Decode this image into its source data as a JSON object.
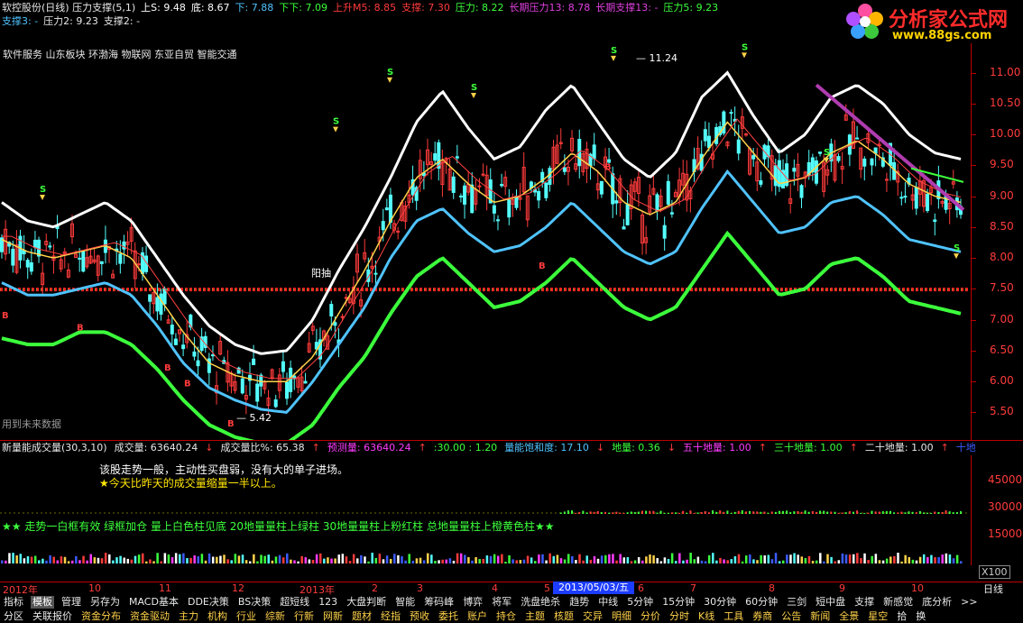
{
  "header": {
    "row1": [
      {
        "text": "软控股份(日线) 压力支撑(5,1)",
        "color": "#e8e8e8"
      },
      {
        "text": "上S: 9.48",
        "color": "#ffffff"
      },
      {
        "text": "底: 8.67",
        "color": "#ffffff"
      },
      {
        "text": "下: 7.88",
        "color": "#4fc3ff"
      },
      {
        "text": "下下: 7.09",
        "color": "#3cff3c"
      },
      {
        "text": "上升M5: 8.85",
        "color": "#ff3b3b"
      },
      {
        "text": "支撑: 7.30",
        "color": "#ff3b3b"
      },
      {
        "text": "压力: 8.22",
        "color": "#3cff3c"
      },
      {
        "text": "长期压力13: 8.78",
        "color": "#e040e0"
      },
      {
        "text": "长期支撑13: -",
        "color": "#e040e0"
      },
      {
        "text": "压力5: 9.23",
        "color": "#3cff3c"
      }
    ],
    "row2": [
      {
        "text": "支撑3: -",
        "color": "#4fc3ff"
      },
      {
        "text": "压力2: 9.23",
        "color": "#e8e8e8"
      },
      {
        "text": "支撑2: -",
        "color": "#e8e8e8"
      }
    ],
    "sectors": "软件服务 山东板块 环渤海 物联网 东亚自贸 智能交通"
  },
  "logo": {
    "title": "分析家公式网",
    "url": "www.88gs.com"
  },
  "price_axis": {
    "ticks": [
      "11.00",
      "10.50",
      "10.00",
      "9.50",
      "9.00",
      "8.50",
      "8.00",
      "7.50",
      "7.00",
      "6.50",
      "6.00",
      "5.50"
    ]
  },
  "annotations": {
    "high_label": "11.24",
    "low_label": "5.42",
    "future_data": "用到未来数据",
    "yinyang_label": "阳抽"
  },
  "volume_header": [
    {
      "text": "新量能成交量(30,3,10)",
      "color": "#e8e8e8"
    },
    {
      "text": "成交量: 63640.24",
      "color": "#e8e8e8"
    },
    {
      "text": "↓",
      "color": "#ff3b3b"
    },
    {
      "text": "成交量比%: 65.38",
      "color": "#e8e8e8"
    },
    {
      "text": "↑",
      "color": "#ff3b3b"
    },
    {
      "text": "预测量: 63640.24",
      "color": "#ff3bff"
    },
    {
      "text": "↑",
      "color": "#ff3b3b"
    },
    {
      "text": ":30.00 : 1.20",
      "color": "#3cff3c"
    },
    {
      "text": "量能饱和度: 17.10",
      "color": "#4fc3ff"
    },
    {
      "text": "↓",
      "color": "#ff3b3b"
    },
    {
      "text": "地量: 0.36",
      "color": "#3cff3c"
    },
    {
      "text": "↓",
      "color": "#ff3b3b"
    },
    {
      "text": "五十地量: 1.00",
      "color": "#ff3bff"
    },
    {
      "text": "↑",
      "color": "#ff3b3b"
    },
    {
      "text": "三十地量: 1.00",
      "color": "#3cff3c"
    },
    {
      "text": "↑",
      "color": "#ff3b3b"
    },
    {
      "text": "二十地量: 1.00",
      "color": "#e8e8e8"
    },
    {
      "text": "↑",
      "color": "#ff3b3b"
    },
    {
      "text": "十地",
      "color": "#3c5cff"
    }
  ],
  "volume_axis": {
    "ticks": [
      "45000",
      "30000",
      "15000"
    ]
  },
  "messages": {
    "msg1": "该股走势一般，主动性买盘弱，没有大的单子进场。",
    "msg2": "★今天比昨天的成交量缩量一半以上。",
    "msg3": "★★ 走势一白框有效 绿框加仓 量上白色柱见底 20地量量柱上绿柱 30地量量柱上粉红柱 总地量量柱上橙黄色柱★★",
    "x100": "X100"
  },
  "time_axis": {
    "labels": [
      "2012年",
      "10",
      "11",
      "12",
      "2013年",
      "2",
      "3",
      "4",
      "5",
      "6",
      "7",
      "8",
      "9",
      "10"
    ],
    "selected_date": "2013/05/03/五",
    "period": "日线"
  },
  "toolbar1": [
    "指标",
    "模板",
    "管理",
    "另存为",
    "MACD基本",
    "DDE决策",
    "BS决策",
    "超短线",
    "123",
    "大盘判断",
    "智能",
    "筹码峰",
    "博弈",
    "将军",
    "洗盘绝杀",
    "趋势",
    "中线",
    "5分钟",
    "15分钟",
    "30分钟",
    "60分钟",
    "三剑",
    "短中盘",
    "支撑",
    "新感觉",
    "底分析",
    ">>"
  ],
  "toolbar2": [
    "分区",
    "关联报价",
    "资金分布",
    "资金驱动",
    "主力",
    "机构",
    "行业",
    "综新",
    "行新",
    "网新",
    "题材",
    "经指",
    "预收",
    "委托",
    "账户",
    "持仓",
    "主题",
    "核题",
    "交异",
    "明细",
    "分价",
    "分时",
    "K线",
    "工具",
    "券商",
    "公告",
    "新闻",
    "全景",
    "星空",
    "拾",
    "换"
  ],
  "chart_data": {
    "type": "candlestick",
    "title": "软控股份(日线)",
    "ylim": [
      5.2,
      11.3
    ],
    "x_range": [
      "2012年",
      "2013年10"
    ],
    "series": [
      {
        "name": "上S",
        "color": "#ffffff",
        "values": [
          8.9,
          8.6,
          8.5,
          8.7,
          8.9,
          8.6,
          8.0,
          7.4,
          6.9,
          6.6,
          6.45,
          6.5,
          7.0,
          7.8,
          8.5,
          9.3,
          10.2,
          10.7,
          10.1,
          9.6,
          9.8,
          10.4,
          10.8,
          10.2,
          9.6,
          9.3,
          9.7,
          10.6,
          11.0,
          10.3,
          9.7,
          10.0,
          10.6,
          10.8,
          10.5,
          10.0,
          9.7,
          9.6
        ]
      },
      {
        "name": "底",
        "color": "#ffd24a",
        "values": [
          8.3,
          8.1,
          8.0,
          8.1,
          8.2,
          8.0,
          7.4,
          6.8,
          6.3,
          6.1,
          6.0,
          6.0,
          6.4,
          7.1,
          7.8,
          8.6,
          9.3,
          9.6,
          9.2,
          8.9,
          9.0,
          9.3,
          9.7,
          9.4,
          8.9,
          8.7,
          8.9,
          9.6,
          10.2,
          9.7,
          9.2,
          9.3,
          9.7,
          9.9,
          9.6,
          9.2,
          9.0,
          8.9
        ]
      },
      {
        "name": "下",
        "color": "#4fc3ff",
        "values": [
          7.6,
          7.4,
          7.4,
          7.5,
          7.6,
          7.4,
          6.9,
          6.3,
          5.9,
          5.7,
          5.55,
          5.5,
          6.0,
          6.6,
          7.2,
          8.0,
          8.6,
          8.8,
          8.4,
          8.1,
          8.2,
          8.5,
          8.9,
          8.5,
          8.1,
          7.9,
          8.1,
          8.8,
          9.4,
          8.9,
          8.4,
          8.5,
          8.9,
          9.0,
          8.7,
          8.3,
          8.2,
          8.1
        ]
      },
      {
        "name": "下下",
        "color": "#3cff3c",
        "values": [
          6.7,
          6.6,
          6.6,
          6.8,
          6.8,
          6.6,
          6.2,
          5.7,
          5.3,
          5.1,
          5.0,
          5.0,
          5.3,
          5.9,
          6.4,
          7.1,
          7.7,
          8.0,
          7.6,
          7.2,
          7.3,
          7.6,
          8.0,
          7.6,
          7.2,
          7.0,
          7.2,
          7.8,
          8.4,
          7.9,
          7.4,
          7.5,
          7.9,
          8.0,
          7.7,
          7.3,
          7.2,
          7.1
        ]
      }
    ],
    "support_level": 7.49,
    "volume_ylim": [
      0,
      55000
    ]
  }
}
